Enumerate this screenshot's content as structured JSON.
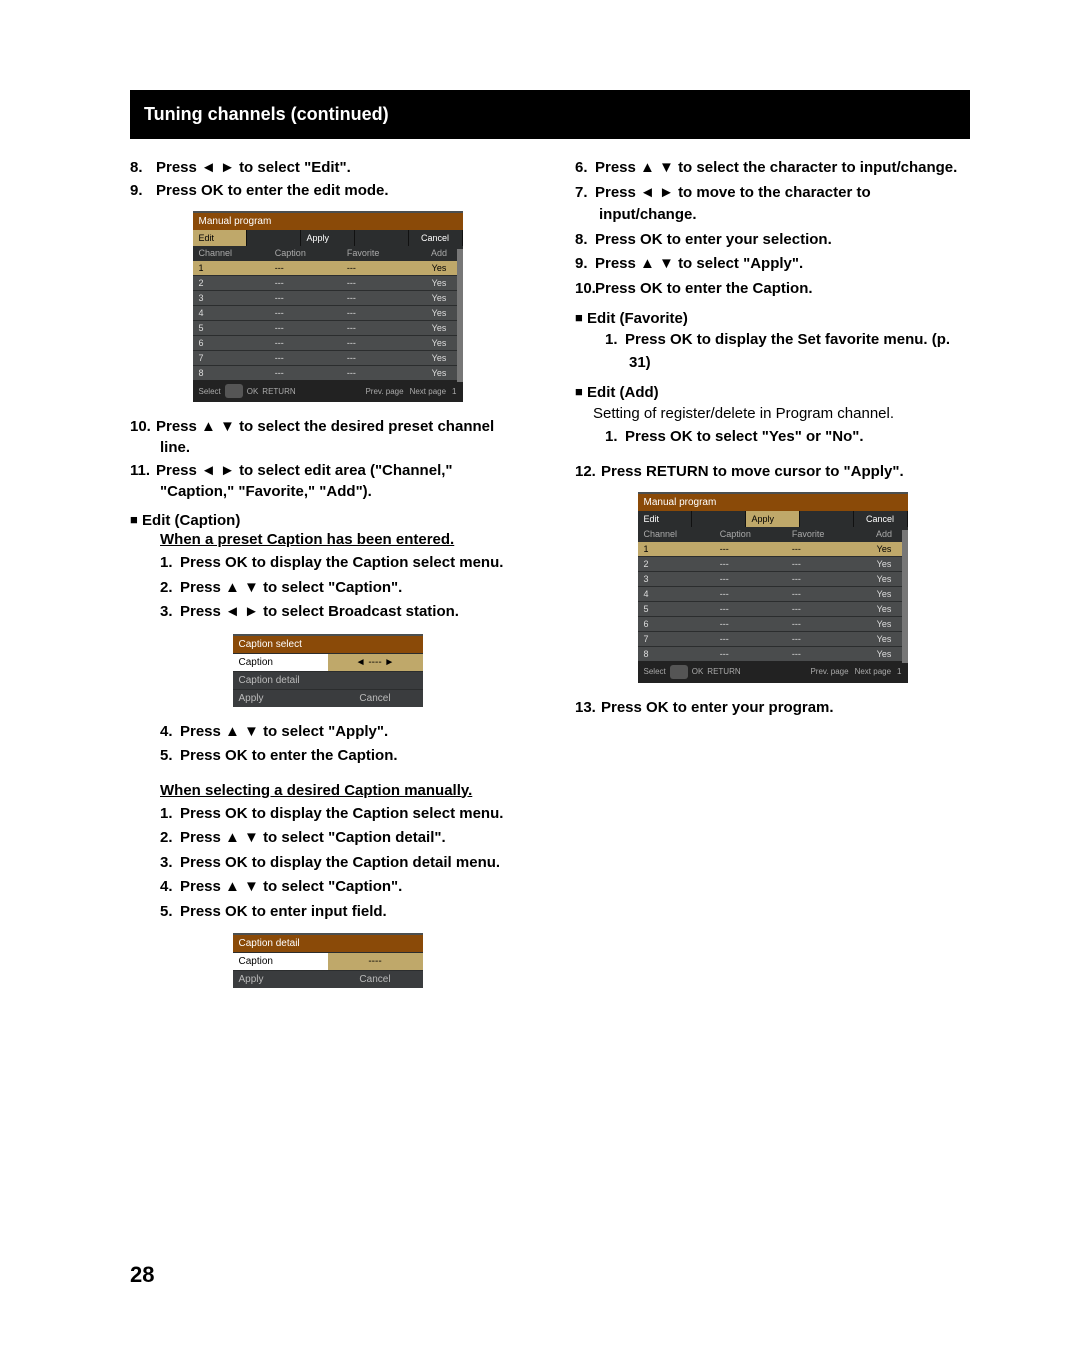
{
  "title": "Tuning channels (continued)",
  "page_number": "28",
  "left": {
    "s8": "Press ◄ ► to select \"Edit\".",
    "s9": "Press OK to enter the edit mode.",
    "s10": "Press ▲ ▼ to select the desired preset channel line.",
    "s11": "Press ◄ ► to select edit area (\"Channel,\" \"Caption,\" \"Favorite,\" \"Add\").",
    "edit_caption": "Edit (Caption)",
    "when_preset": "When a preset Caption has been entered.",
    "ec1": "Press OK to display the Caption select menu.",
    "ec2": "Press ▲ ▼ to select \"Caption\".",
    "ec3": "Press ◄ ► to select Broadcast station.",
    "ec4": "Press ▲ ▼ to select \"Apply\".",
    "ec5": "Press OK to enter the Caption.",
    "when_manual": "When selecting a desired Caption manually.",
    "em1": "Press OK to display the Caption select menu.",
    "em2": "Press ▲ ▼ to select \"Caption detail\".",
    "em3": "Press OK to display the Caption detail menu.",
    "em4": "Press ▲ ▼ to select \"Caption\".",
    "em5": "Press OK to enter input field."
  },
  "right": {
    "s6": "Press ▲ ▼ to select the character to input/change.",
    "s7": "Press ◄ ► to move to the character to input/change.",
    "s8": "Press OK to enter your selection.",
    "s9": "Press ▲ ▼ to select \"Apply\".",
    "s10": "Press OK to enter the Caption.",
    "edit_favorite": "Edit (Favorite)",
    "ef1": "Press OK to display the Set favorite menu. (p. 31)",
    "edit_add": "Edit (Add)",
    "ea_desc": "Setting of register/delete in Program channel.",
    "ea1": "Press OK to select \"Yes\" or \"No\".",
    "s12": "Press RETURN to move cursor to \"Apply\".",
    "s13": "Press OK to enter your program."
  },
  "osd_full": {
    "title": "Manual program",
    "tab_edit": "Edit",
    "tab_apply": "Apply",
    "tab_cancel": "Cancel",
    "col_channel": "Channel",
    "col_caption": "Caption",
    "col_favorite": "Favorite",
    "col_add": "Add",
    "rows": [
      {
        "ch": "1",
        "cap": "---",
        "fav": "---",
        "add": "Yes"
      },
      {
        "ch": "2",
        "cap": "---",
        "fav": "---",
        "add": "Yes"
      },
      {
        "ch": "3",
        "cap": "---",
        "fav": "---",
        "add": "Yes"
      },
      {
        "ch": "4",
        "cap": "---",
        "fav": "---",
        "add": "Yes"
      },
      {
        "ch": "5",
        "cap": "---",
        "fav": "---",
        "add": "Yes"
      },
      {
        "ch": "6",
        "cap": "---",
        "fav": "---",
        "add": "Yes"
      },
      {
        "ch": "7",
        "cap": "---",
        "fav": "---",
        "add": "Yes"
      },
      {
        "ch": "8",
        "cap": "---",
        "fav": "---",
        "add": "Yes"
      }
    ],
    "footer_select": "Select",
    "footer_ok": "OK",
    "footer_return": "RETURN",
    "footer_prev": "Prev. page",
    "footer_next": "Next page",
    "footer_page": "1"
  },
  "osd_caption_select": {
    "title": "Caption select",
    "row_caption": "Caption",
    "row_caption_val": "----",
    "row_detail": "Caption detail",
    "row_apply": "Apply",
    "row_cancel": "Cancel"
  },
  "osd_caption_detail": {
    "title": "Caption detail",
    "row_caption": "Caption",
    "row_caption_val": "----",
    "row_apply": "Apply",
    "row_cancel": "Cancel"
  }
}
